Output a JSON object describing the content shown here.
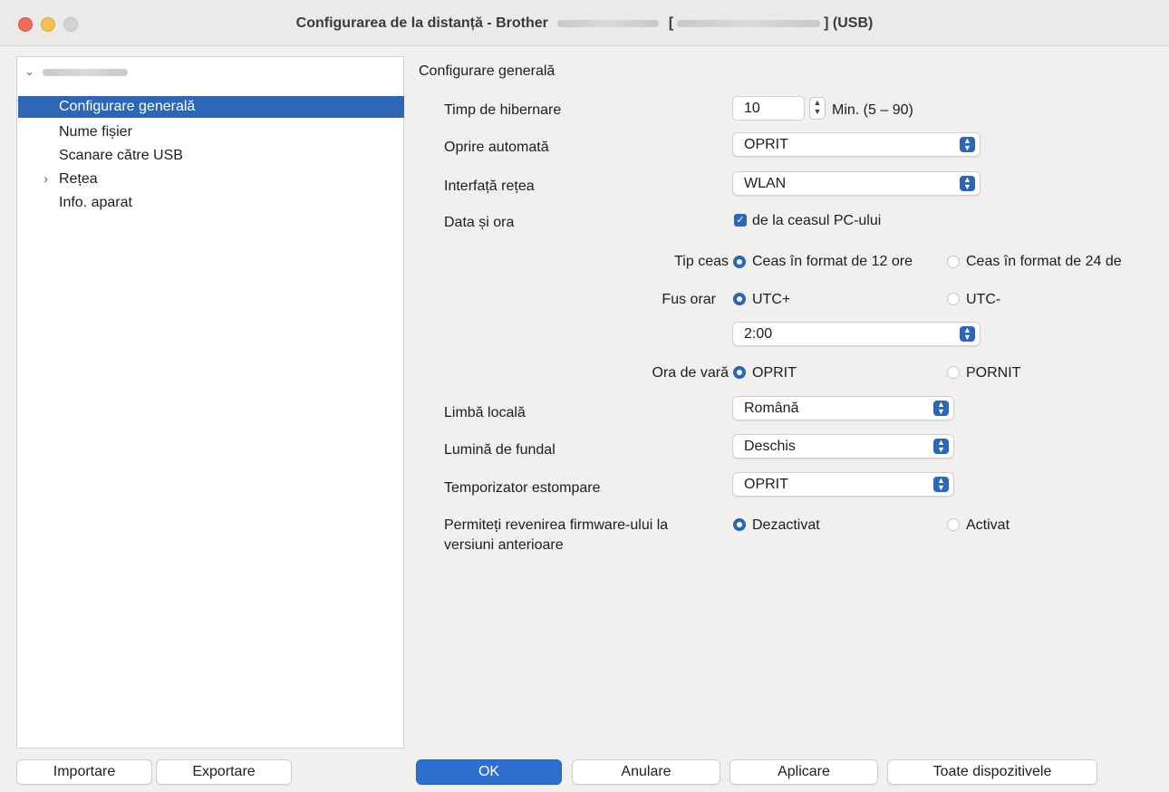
{
  "window": {
    "title_prefix": "Configurarea de la distanță - Brother",
    "title_bracket_open": "[",
    "title_suffix": "] (USB)"
  },
  "sidebar": {
    "items": [
      {
        "label": "Configurare generală",
        "selected": true
      },
      {
        "label": "Nume fișier"
      },
      {
        "label": "Scanare către USB"
      },
      {
        "label": "Rețea",
        "expandable": true
      },
      {
        "label": "Info. aparat"
      }
    ]
  },
  "panel": {
    "title": "Configurare generală",
    "sleep": {
      "label": "Timp de hibernare",
      "value": "10",
      "range": "Min. (5 – 90)"
    },
    "auto_off": {
      "label": "Oprire automată",
      "value": "OPRIT"
    },
    "net_if": {
      "label": "Interfață rețea",
      "value": "WLAN"
    },
    "datetime": {
      "label": "Data și ora",
      "sync_label": "de la ceasul PC-ului",
      "sync_checked": true,
      "clock_type": {
        "label": "Tip ceas",
        "opt1": "Ceas în format de 12 ore",
        "opt2": "Ceas în format de 24 de"
      },
      "timezone": {
        "label": "Fus orar",
        "opt1": "UTC+",
        "opt2": "UTC-",
        "value": "2:00"
      },
      "dst": {
        "label": "Ora de vară",
        "opt1": "OPRIT",
        "opt2": "PORNIT"
      }
    },
    "lang": {
      "label": "Limbă locală",
      "value": "Română"
    },
    "backlight": {
      "label": "Lumină de fundal",
      "value": "Deschis"
    },
    "dim_timer": {
      "label": "Temporizator estompare",
      "value": "OPRIT"
    },
    "firmware": {
      "label_line1": "Permiteți revenirea firmware-ului la",
      "label_line2": "versiuni anterioare",
      "opt1": "Dezactivat",
      "opt2": "Activat"
    }
  },
  "buttons": {
    "import": "Importare",
    "export": "Exportare",
    "ok": "OK",
    "cancel": "Anulare",
    "apply": "Aplicare",
    "all_devices": "Toate dispozitivele"
  },
  "colors": {
    "accent": "#2d66b6",
    "primary_button": "#2e6ecd",
    "selection": "#2d66b6"
  }
}
